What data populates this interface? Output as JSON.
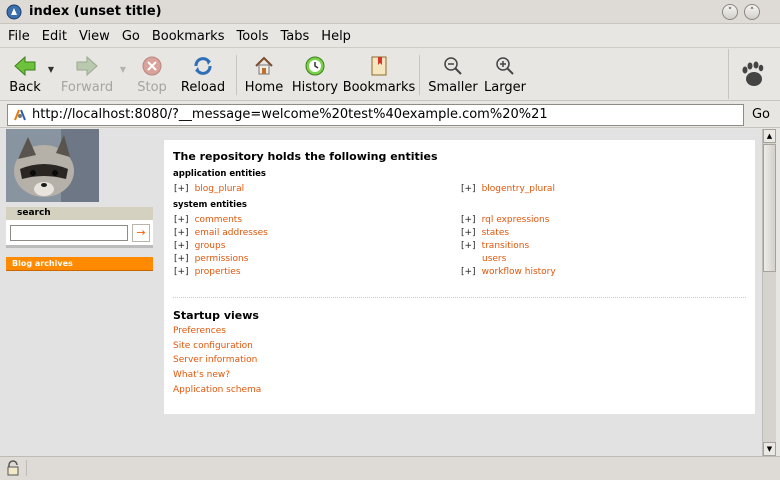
{
  "window": {
    "title": "index (unset title)"
  },
  "menu": [
    "File",
    "Edit",
    "View",
    "Go",
    "Bookmarks",
    "Tools",
    "Tabs",
    "Help"
  ],
  "toolbar": {
    "back": "Back",
    "forward": "Forward",
    "stop": "Stop",
    "reload": "Reload",
    "home": "Home",
    "history": "History",
    "bookmarks": "Bookmarks",
    "smaller": "Smaller",
    "larger": "Larger"
  },
  "location": {
    "url": "http://localhost:8080/?__message=welcome%20test%40example.com%20%21",
    "go": "Go"
  },
  "sidebar": {
    "search_title": "search",
    "search_value": "",
    "search_go": "→",
    "archives": "Blog archives"
  },
  "page": {
    "title": "The repository holds the following entities",
    "app_section": "application entities",
    "app_entities_left": [
      {
        "plus": "[+]",
        "label": "blog_plural"
      }
    ],
    "app_entities_right": [
      {
        "plus": "[+]",
        "label": "blogentry_plural"
      }
    ],
    "sys_section": "system entities",
    "sys_entities_left": [
      {
        "plus": "[+]",
        "label": "comments"
      },
      {
        "plus": "[+]",
        "label": "email addresses"
      },
      {
        "plus": "[+]",
        "label": "groups"
      },
      {
        "plus": "[+]",
        "label": "permissions"
      },
      {
        "plus": "[+]",
        "label": "properties"
      }
    ],
    "sys_entities_right": [
      {
        "plus": "[+]",
        "label": "rql expressions"
      },
      {
        "plus": "[+]",
        "label": "states"
      },
      {
        "plus": "[+]",
        "label": "transitions"
      },
      {
        "plus": "",
        "label": "users"
      },
      {
        "plus": "[+]",
        "label": "workflow history"
      }
    ],
    "startup_title": "Startup views",
    "startup_links": [
      "Preferences",
      "Site configuration",
      "Server information",
      "What's new?",
      "Application schema"
    ]
  },
  "colors": {
    "link": "#e0570c",
    "archives_bg": "#ff8a00",
    "box_title_bg": "#d4d1c0"
  },
  "icons": {
    "back": "green-left-arrow-icon",
    "forward": "right-arrow-icon",
    "stop": "stop-icon",
    "reload": "reload-icon",
    "home": "home-icon",
    "history": "history-clock-icon",
    "bookmarks": "bookmarks-book-icon",
    "smaller": "zoom-out-icon",
    "larger": "zoom-in-icon",
    "throbber": "gnome-foot-icon",
    "lock": "padlock-icon"
  }
}
